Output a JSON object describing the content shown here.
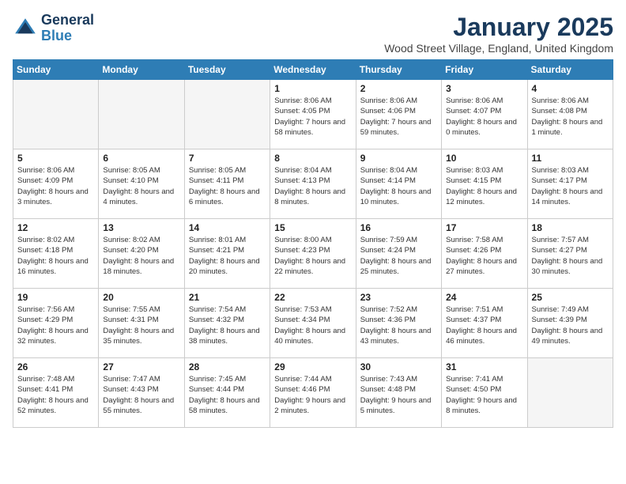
{
  "header": {
    "logo_line1": "General",
    "logo_line2": "Blue",
    "month": "January 2025",
    "location": "Wood Street Village, England, United Kingdom"
  },
  "weekdays": [
    "Sunday",
    "Monday",
    "Tuesday",
    "Wednesday",
    "Thursday",
    "Friday",
    "Saturday"
  ],
  "weeks": [
    [
      {
        "day": "",
        "text": ""
      },
      {
        "day": "",
        "text": ""
      },
      {
        "day": "",
        "text": ""
      },
      {
        "day": "1",
        "text": "Sunrise: 8:06 AM\nSunset: 4:05 PM\nDaylight: 7 hours and 58 minutes."
      },
      {
        "day": "2",
        "text": "Sunrise: 8:06 AM\nSunset: 4:06 PM\nDaylight: 7 hours and 59 minutes."
      },
      {
        "day": "3",
        "text": "Sunrise: 8:06 AM\nSunset: 4:07 PM\nDaylight: 8 hours and 0 minutes."
      },
      {
        "day": "4",
        "text": "Sunrise: 8:06 AM\nSunset: 4:08 PM\nDaylight: 8 hours and 1 minute."
      }
    ],
    [
      {
        "day": "5",
        "text": "Sunrise: 8:06 AM\nSunset: 4:09 PM\nDaylight: 8 hours and 3 minutes."
      },
      {
        "day": "6",
        "text": "Sunrise: 8:05 AM\nSunset: 4:10 PM\nDaylight: 8 hours and 4 minutes."
      },
      {
        "day": "7",
        "text": "Sunrise: 8:05 AM\nSunset: 4:11 PM\nDaylight: 8 hours and 6 minutes."
      },
      {
        "day": "8",
        "text": "Sunrise: 8:04 AM\nSunset: 4:13 PM\nDaylight: 8 hours and 8 minutes."
      },
      {
        "day": "9",
        "text": "Sunrise: 8:04 AM\nSunset: 4:14 PM\nDaylight: 8 hours and 10 minutes."
      },
      {
        "day": "10",
        "text": "Sunrise: 8:03 AM\nSunset: 4:15 PM\nDaylight: 8 hours and 12 minutes."
      },
      {
        "day": "11",
        "text": "Sunrise: 8:03 AM\nSunset: 4:17 PM\nDaylight: 8 hours and 14 minutes."
      }
    ],
    [
      {
        "day": "12",
        "text": "Sunrise: 8:02 AM\nSunset: 4:18 PM\nDaylight: 8 hours and 16 minutes."
      },
      {
        "day": "13",
        "text": "Sunrise: 8:02 AM\nSunset: 4:20 PM\nDaylight: 8 hours and 18 minutes."
      },
      {
        "day": "14",
        "text": "Sunrise: 8:01 AM\nSunset: 4:21 PM\nDaylight: 8 hours and 20 minutes."
      },
      {
        "day": "15",
        "text": "Sunrise: 8:00 AM\nSunset: 4:23 PM\nDaylight: 8 hours and 22 minutes."
      },
      {
        "day": "16",
        "text": "Sunrise: 7:59 AM\nSunset: 4:24 PM\nDaylight: 8 hours and 25 minutes."
      },
      {
        "day": "17",
        "text": "Sunrise: 7:58 AM\nSunset: 4:26 PM\nDaylight: 8 hours and 27 minutes."
      },
      {
        "day": "18",
        "text": "Sunrise: 7:57 AM\nSunset: 4:27 PM\nDaylight: 8 hours and 30 minutes."
      }
    ],
    [
      {
        "day": "19",
        "text": "Sunrise: 7:56 AM\nSunset: 4:29 PM\nDaylight: 8 hours and 32 minutes."
      },
      {
        "day": "20",
        "text": "Sunrise: 7:55 AM\nSunset: 4:31 PM\nDaylight: 8 hours and 35 minutes."
      },
      {
        "day": "21",
        "text": "Sunrise: 7:54 AM\nSunset: 4:32 PM\nDaylight: 8 hours and 38 minutes."
      },
      {
        "day": "22",
        "text": "Sunrise: 7:53 AM\nSunset: 4:34 PM\nDaylight: 8 hours and 40 minutes."
      },
      {
        "day": "23",
        "text": "Sunrise: 7:52 AM\nSunset: 4:36 PM\nDaylight: 8 hours and 43 minutes."
      },
      {
        "day": "24",
        "text": "Sunrise: 7:51 AM\nSunset: 4:37 PM\nDaylight: 8 hours and 46 minutes."
      },
      {
        "day": "25",
        "text": "Sunrise: 7:49 AM\nSunset: 4:39 PM\nDaylight: 8 hours and 49 minutes."
      }
    ],
    [
      {
        "day": "26",
        "text": "Sunrise: 7:48 AM\nSunset: 4:41 PM\nDaylight: 8 hours and 52 minutes."
      },
      {
        "day": "27",
        "text": "Sunrise: 7:47 AM\nSunset: 4:43 PM\nDaylight: 8 hours and 55 minutes."
      },
      {
        "day": "28",
        "text": "Sunrise: 7:45 AM\nSunset: 4:44 PM\nDaylight: 8 hours and 58 minutes."
      },
      {
        "day": "29",
        "text": "Sunrise: 7:44 AM\nSunset: 4:46 PM\nDaylight: 9 hours and 2 minutes."
      },
      {
        "day": "30",
        "text": "Sunrise: 7:43 AM\nSunset: 4:48 PM\nDaylight: 9 hours and 5 minutes."
      },
      {
        "day": "31",
        "text": "Sunrise: 7:41 AM\nSunset: 4:50 PM\nDaylight: 9 hours and 8 minutes."
      },
      {
        "day": "",
        "text": ""
      }
    ]
  ]
}
